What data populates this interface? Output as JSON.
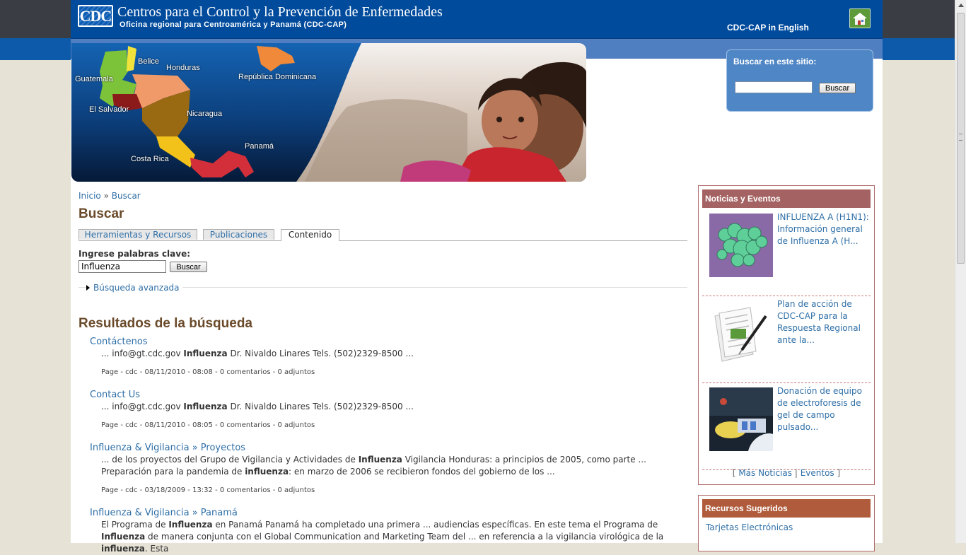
{
  "header": {
    "logo_text": "CDC",
    "title": "Centros para el Control y la Prevención de Enfermedades",
    "subtitle": "Oficina regional para Centroamérica y Panamá (CDC-CAP)",
    "english_link": "CDC-CAP in English",
    "home_icon": "home-icon"
  },
  "hero": {
    "labels": {
      "belice": "Belice",
      "honduras": "Honduras",
      "guatemala": "Guatemala",
      "el_salvador": "El Salvador",
      "nicaragua": "Nicaragua",
      "costa_rica": "Costa Rica",
      "panama": "Panamá",
      "rep_dom": "República Dominicana"
    },
    "colors": {
      "guatemala": "#7dc33a",
      "belice": "#f2e33c",
      "honduras": "#f09a6a",
      "el_salvador": "#8b1a1a",
      "nicaragua": "#9a6a12",
      "costa_rica": "#f3c21a",
      "panama": "#d22f3a",
      "rep_dom": "#f08a3a"
    }
  },
  "site_search": {
    "title": "Buscar en este sitio:",
    "value": "",
    "button": "Buscar"
  },
  "breadcrumb": {
    "home": "Inicio",
    "separator": "»",
    "current": "Buscar"
  },
  "page_title": "Buscar",
  "tabs": [
    {
      "label": "Herramientas y Recursos",
      "active": false
    },
    {
      "label": "Publicaciones",
      "active": false
    },
    {
      "label": "Contenido",
      "active": true
    }
  ],
  "search_form": {
    "label": "Ingrese palabras clave:",
    "value": "Influenza",
    "button": "Buscar",
    "advanced": "Búsqueda avanzada"
  },
  "results_title": "Resultados de la búsqueda",
  "results": [
    {
      "title": "Contáctenos",
      "s1": "... info@gt.cdc.gov  ",
      "b1": "Influenza",
      "s2": " Dr. Nivaldo Linares Tels. (502)2329-8500 ...",
      "meta": "Page - cdc - 08/11/2010 - 08:08 - 0 comentarios - 0 adjuntos"
    },
    {
      "title": "Contact Us",
      "s1": "... info@gt.cdc.gov  ",
      "b1": "Influenza",
      "s2": " Dr. Nivaldo Linares Tels. (502)2329-8500 ...",
      "meta": "Page - cdc - 08/11/2010 - 08:05 - 0 comentarios - 0 adjuntos"
    },
    {
      "title": "Influenza & Vigilancia » Proyectos",
      "s1": "... de los proyectos del Grupo de Vigilancia y Actividades de ",
      "b1": "Influenza",
      "s2": " Vigilancia Honduras: a principios de 2005, como parte ... Preparación para la pandemia de ",
      "b2": "influenza",
      "s3": ": en marzo de 2006 se recibieron fondos del gobierno de los ...",
      "meta": "Page - cdc - 03/18/2009 - 13:32 - 0 comentarios - 0 adjuntos"
    },
    {
      "title": "Influenza & Vigilancia » Panamá",
      "s1": "El Programa de ",
      "b1": "Influenza",
      "s2": " en Panamá Panamá ha completado una primera ... audiencias específicas. En este tema el Programa de ",
      "b2": "Influenza",
      "s3": " de manera conjunta con el Global Communication and Marketing Team del ... en referencia a la vigilancia virológica de la ",
      "b3": "influenza",
      "s4": ". Esta"
    }
  ],
  "news": {
    "title": "Noticias y Eventos",
    "items": [
      {
        "text": "INFLUENZA A (H1N1): Información general de Influenza A (H...",
        "thumb": "virus-micrograph"
      },
      {
        "text": "Plan de acción de CDC-CAP para la Respuesta Regional ante la...",
        "thumb": "document-pen"
      },
      {
        "text": "Donación de equipo de electroforesis de gel de campo pulsado...",
        "thumb": "lab-photo"
      }
    ],
    "more_open": "[",
    "more_news": "Más Noticias",
    "pipe": "|",
    "events": "Eventos",
    "more_close": "]"
  },
  "resources": {
    "title": "Recursos Sugeridos",
    "item1": "Tarjetas Electrónicas"
  }
}
